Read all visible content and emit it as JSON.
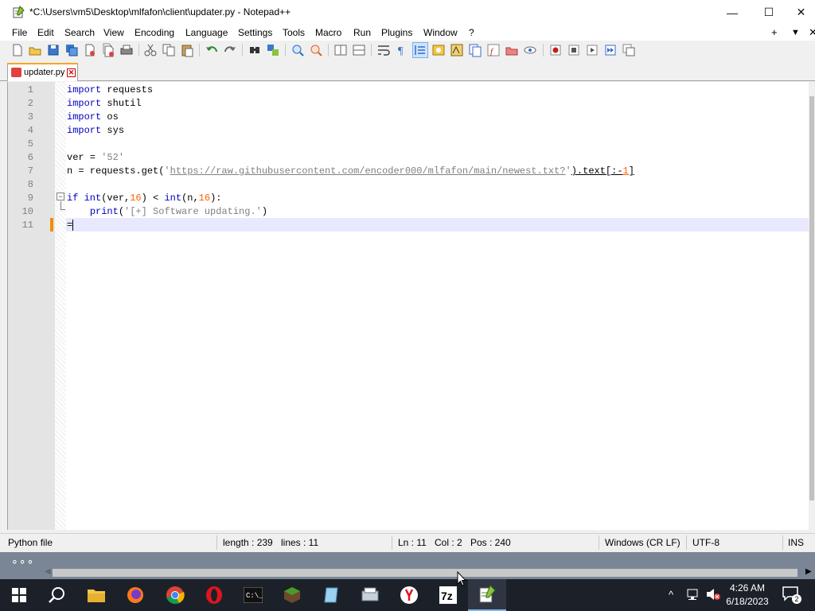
{
  "window": {
    "title": "*C:\\Users\\vm5\\Desktop\\mlfafon\\client\\updater.py - Notepad++",
    "minimize_glyph": "—",
    "maximize_glyph": "☐",
    "close_glyph": "✕"
  },
  "menu": {
    "items": [
      "File",
      "Edit",
      "Search",
      "View",
      "Encoding",
      "Language",
      "Settings",
      "Tools",
      "Macro",
      "Run",
      "Plugins",
      "Window",
      "?"
    ],
    "right_controls": [
      "+",
      "▼",
      "✕"
    ]
  },
  "toolbar": {
    "icons": [
      "new-file-icon",
      "open-file-icon",
      "save-icon",
      "save-all-icon",
      "close-icon",
      "close-all-icon",
      "print-icon",
      "cut-icon",
      "copy-icon",
      "paste-icon",
      "undo-icon",
      "redo-icon",
      "find-icon",
      "replace-icon",
      "zoom-in-icon",
      "zoom-out-icon",
      "sync-vertical-icon",
      "sync-horizontal-icon",
      "word-wrap-icon",
      "show-all-chars-icon",
      "indent-guide-icon",
      "udl-icon",
      "document-map-icon",
      "document-list-icon",
      "function-list-icon",
      "folder-as-workspace-icon",
      "monitoring-icon",
      "record-macro-icon",
      "stop-macro-icon",
      "play-macro-icon",
      "run-macro-multiple-icon",
      "save-macro-icon"
    ]
  },
  "tab": {
    "label": "updater.py",
    "close_glyph": "✕"
  },
  "editor": {
    "line_numbers": [
      "1",
      "2",
      "3",
      "4",
      "5",
      "6",
      "7",
      "8",
      "9",
      "10",
      "11"
    ],
    "fold_toggle": "−",
    "lines": {
      "l1_kw": "import",
      "l1_rest": " requests",
      "l2_kw": "import",
      "l2_rest": " shutil",
      "l3_kw": "import",
      "l3_rest": " os",
      "l4_kw": "import",
      "l4_rest": " sys",
      "l6_a": "ver = ",
      "l6_str": "'52'",
      "l7_a": "n = requests.get(",
      "l7_q1": "'",
      "l7_url": "https://raw.githubusercontent.com/encoder000/mlfafon/main/newest.txt?",
      "l7_q2": "'",
      "l7_b": ").text[:-",
      "l7_num": "1",
      "l7_c": "]",
      "l9_kw1": "if",
      "l9_sp": " ",
      "l9_kw2": "int",
      "l9_a": "(ver,",
      "l9_num1": "16",
      "l9_b": ") < ",
      "l9_kw3": "int",
      "l9_c": "(n,",
      "l9_num2": "16",
      "l9_d": "):",
      "l10_indent": "    ",
      "l10_kw": "print",
      "l10_a": "(",
      "l10_str": "'[+] Software updating.'",
      "l10_b": ")",
      "l11": "="
    }
  },
  "status": {
    "filetype": "Python file",
    "length": "length : 239",
    "lines": "lines : 11",
    "ln": "Ln : 11",
    "col": "Col : 2",
    "pos": "Pos : 240",
    "eol": "Windows (CR LF)",
    "encoding": "UTF-8",
    "mode": "INS"
  },
  "desktop": {
    "dots": "∘∘∘"
  },
  "taskbar": {
    "apps": [
      "start-icon",
      "search-icon",
      "file-explorer-icon",
      "firefox-icon",
      "chrome-icon",
      "opera-icon",
      "terminal-icon",
      "minecraft-icon",
      "notepad-icon",
      "scanner-icon",
      "yandex-icon",
      "7zip-icon",
      "notepad-plus-plus-icon"
    ],
    "tray_chevron": "^",
    "clock_time": "4:26 AM",
    "clock_date": "6/18/2023",
    "notification_count": "2"
  },
  "colors": {
    "keyword": "#0000c0",
    "number": "#ff6000",
    "string": "#808080",
    "current_line": "#e8e8ff",
    "change_marker": "#f58b00",
    "taskbar": "#1c2129"
  }
}
